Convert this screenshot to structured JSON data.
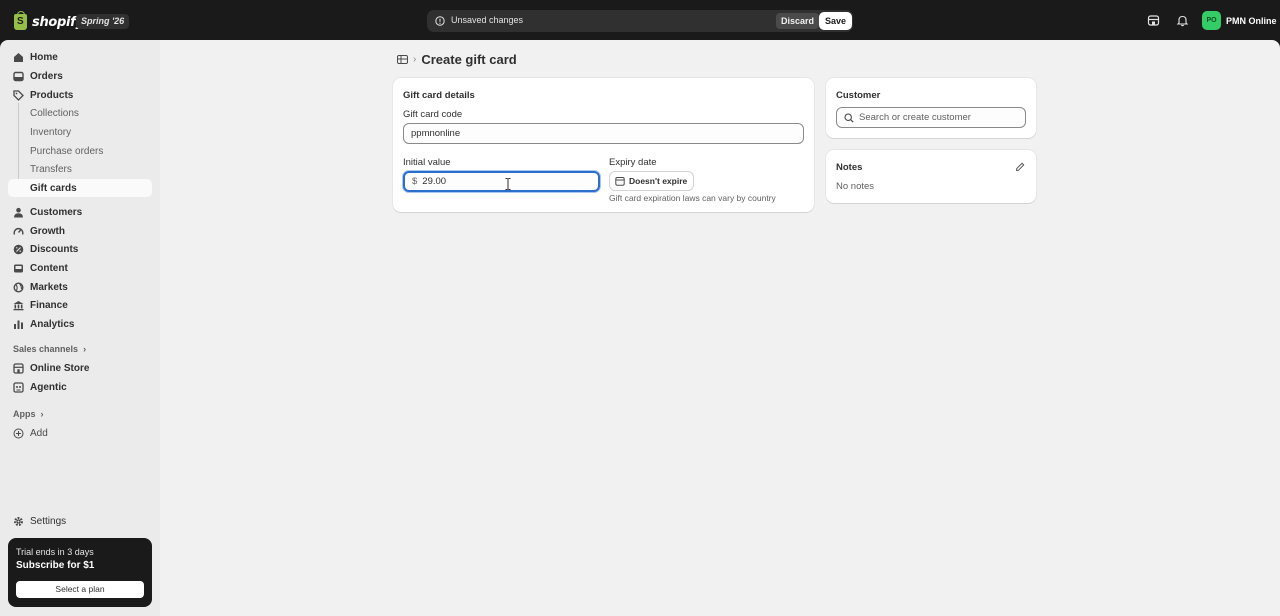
{
  "topbar": {
    "logo_text": "shopify",
    "logo_mark": "S",
    "edition": "Spring '26",
    "save_bar": {
      "message": "Unsaved changes",
      "discard_label": "Discard",
      "save_label": "Save"
    },
    "icons": [
      "store-icon",
      "bell-icon"
    ],
    "store": {
      "initials": "PO",
      "name": "PMN Online"
    }
  },
  "sidebar": {
    "items": [
      {
        "label": "Home",
        "icon": "home-icon"
      },
      {
        "label": "Orders",
        "icon": "inbox-icon"
      },
      {
        "label": "Products",
        "icon": "tag-icon"
      }
    ],
    "product_sub": [
      "Collections",
      "Inventory",
      "Purchase orders",
      "Transfers",
      "Gift cards"
    ],
    "items2": [
      {
        "label": "Customers",
        "icon": "person-icon"
      },
      {
        "label": "Growth",
        "icon": "gauge-icon"
      },
      {
        "label": "Discounts",
        "icon": "discount-icon"
      },
      {
        "label": "Content",
        "icon": "content-icon"
      },
      {
        "label": "Markets",
        "icon": "globe-icon"
      },
      {
        "label": "Finance",
        "icon": "bank-icon"
      },
      {
        "label": "Analytics",
        "icon": "bar-chart-icon"
      }
    ],
    "sales_channels_label": "Sales channels",
    "channels": [
      {
        "label": "Online Store",
        "icon": "storefront-icon"
      },
      {
        "label": "Agentic",
        "icon": "agentic-icon"
      }
    ],
    "apps_label": "Apps",
    "add_label": "Add",
    "settings_label": "Settings",
    "trial": {
      "line1": "Trial ends in 3 days",
      "line2": "Subscribe for $1",
      "button": "Select a plan"
    }
  },
  "page": {
    "title": "Create gift card",
    "details_card": {
      "title": "Gift card details",
      "code_label": "Gift card code",
      "code_value": "ppmnonline",
      "initial_value_label": "Initial value",
      "currency_prefix": "$",
      "initial_value": "29.00",
      "expiry_label": "Expiry date",
      "expiry_button": "Doesn't expire",
      "expiry_help": "Gift card expiration laws can vary by country"
    },
    "customer_card": {
      "title": "Customer",
      "search_placeholder": "Search or create customer"
    },
    "notes_card": {
      "title": "Notes",
      "empty_text": "No notes"
    }
  },
  "colors": {
    "accent_focus": "#2c6ecb",
    "topbar_bg": "#1a1a1a",
    "avatar_green": "#33cc66",
    "logo_green": "#95bf47"
  }
}
